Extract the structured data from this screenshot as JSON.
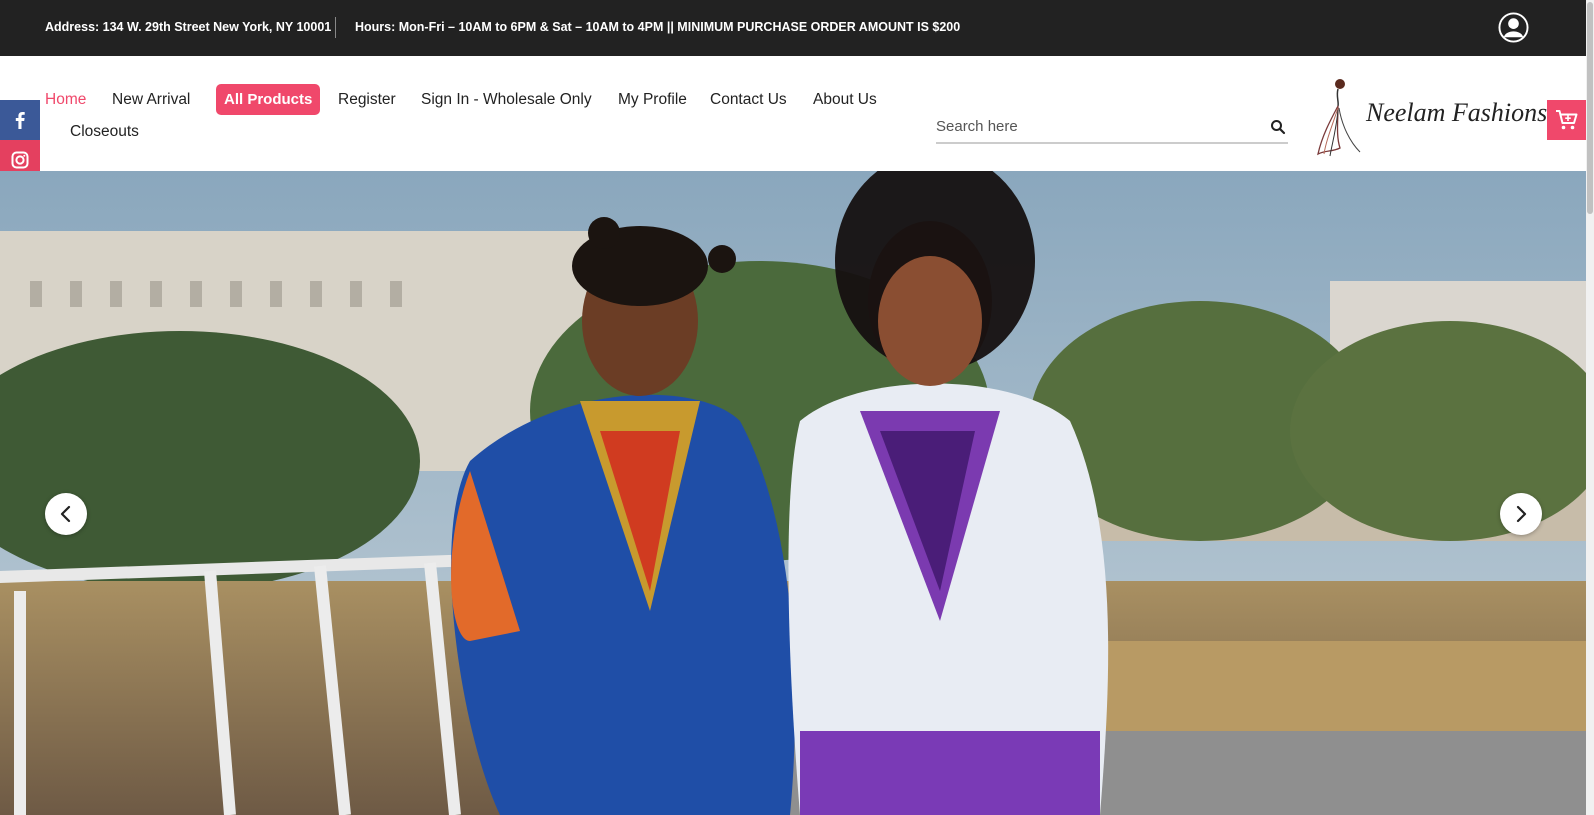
{
  "topbar": {
    "address": "Address: 134 W. 29th Street New York, NY 10001",
    "hours": "Hours: Mon-Fri – 10AM to 6PM & Sat – 10AM to 4PM || MINIMUM PURCHASE ORDER AMOUNT IS $200"
  },
  "nav": {
    "home": "Home",
    "new_arrival": "New Arrival",
    "all_products": "All Products",
    "register": "Register",
    "sign_in": "Sign In - Wholesale Only",
    "my_profile": "My Profile",
    "contact_us": "Contact Us",
    "about_us": "About Us",
    "closeouts": "Closeouts"
  },
  "search": {
    "placeholder": "Search here"
  },
  "brand": {
    "name": "Neelam Fashions"
  },
  "colors": {
    "accent": "#f0486b",
    "topbar": "#222222",
    "facebook": "#3b5998",
    "instagram": "#e4405f"
  },
  "icons": {
    "user": "user-circle-icon",
    "search": "search-icon",
    "cart": "cart-icon",
    "facebook": "facebook-icon",
    "instagram": "instagram-icon",
    "prev": "chevron-left-icon",
    "next": "chevron-right-icon"
  }
}
